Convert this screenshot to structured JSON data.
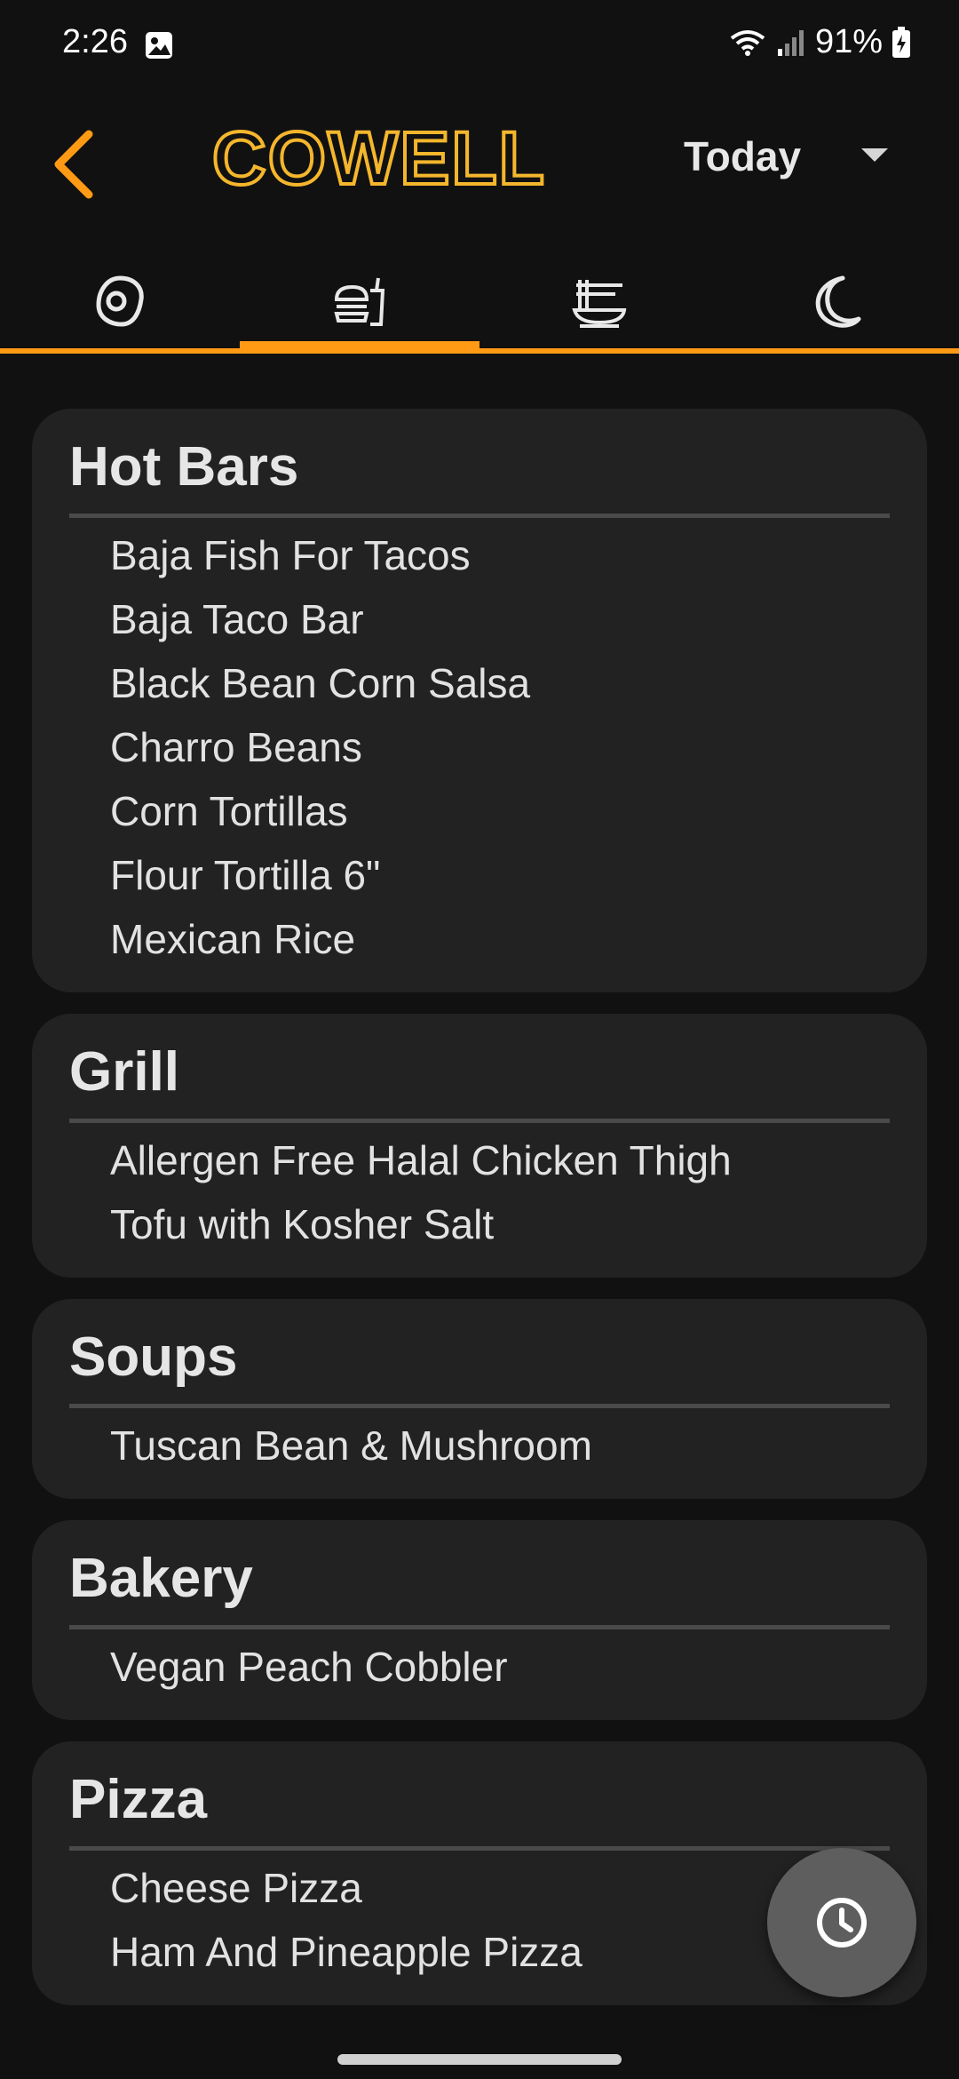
{
  "status_bar": {
    "time": "2:26",
    "battery": "91%",
    "icons": [
      "gallery-icon",
      "wifi-icon",
      "signal-icon",
      "battery-charging-icon"
    ]
  },
  "header": {
    "back_icon": "chevron-left-icon",
    "logo_text": "COWELL",
    "date_selected": "Today",
    "accent_color": "#ff9a14"
  },
  "tabs": [
    {
      "icon": "breakfast-egg-icon",
      "selected": false
    },
    {
      "icon": "lunch-burger-icon",
      "selected": true
    },
    {
      "icon": "dinner-noodles-icon",
      "selected": false
    },
    {
      "icon": "late-night-moon-icon",
      "selected": false
    }
  ],
  "menu": [
    {
      "title": "Hot Bars",
      "items": [
        "Baja Fish For Tacos",
        "Baja Taco Bar",
        "Black Bean Corn Salsa",
        "Charro Beans",
        "Corn Tortillas",
        "Flour Tortilla 6\"",
        "Mexican Rice"
      ]
    },
    {
      "title": "Grill",
      "items": [
        "Allergen Free Halal Chicken Thigh",
        "Tofu with Kosher Salt"
      ]
    },
    {
      "title": "Soups",
      "items": [
        "Tuscan Bean & Mushroom"
      ]
    },
    {
      "title": "Bakery",
      "items": [
        "Vegan Peach Cobbler"
      ]
    },
    {
      "title": "Pizza",
      "items": [
        "Cheese Pizza",
        "Ham And Pineapple Pizza"
      ]
    }
  ],
  "fab": {
    "icon": "clock-icon"
  }
}
